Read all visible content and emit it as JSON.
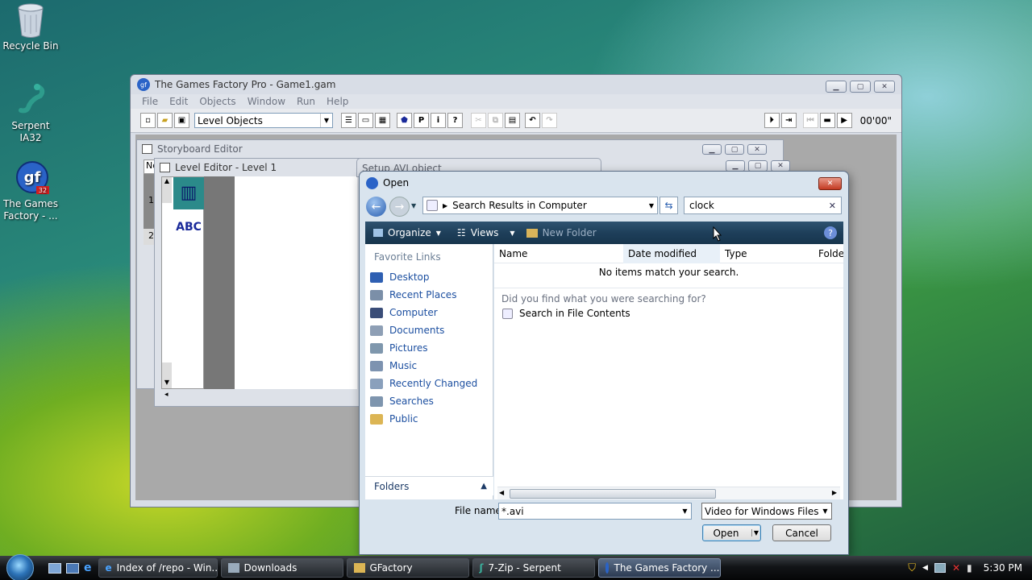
{
  "desktop": {
    "icons": [
      {
        "label": "Recycle Bin"
      },
      {
        "label": "Serpent IA32"
      },
      {
        "label": "The Games Factory - ..."
      }
    ]
  },
  "app": {
    "title": "The Games Factory Pro - Game1.gam",
    "menu": [
      "File",
      "Edit",
      "Objects",
      "Window",
      "Run",
      "Help"
    ],
    "objects_combo": "Level Objects",
    "timer": "00'00\""
  },
  "storyboard": {
    "title": "Storyboard Editor",
    "col_header": "No",
    "rows": [
      "1",
      "2"
    ]
  },
  "level_editor": {
    "title": "Level Editor - Level 1",
    "abc_label": "ABC"
  },
  "setup_avi": {
    "title": "Setup AVI object"
  },
  "open_dialog": {
    "title": "Open",
    "address": "Search Results in Computer",
    "search_value": "clock",
    "organize": "Organize",
    "views": "Views",
    "new_folder": "New Folder",
    "favorite_links": "Favorite Links",
    "links": [
      "Desktop",
      "Recent Places",
      "Computer",
      "Documents",
      "Pictures",
      "Music",
      "Recently Changed",
      "Searches",
      "Public"
    ],
    "folders": "Folders",
    "columns": [
      "Name",
      "Date modified",
      "Type",
      "Folde"
    ],
    "empty_message": "No items match your search.",
    "did_you_find": "Did you find what you were searching for?",
    "search_in_contents": "Search in File Contents",
    "filename_label": "File name:",
    "filename_value": "*.avi",
    "filetype": "Video for Windows Files",
    "open_btn": "Open",
    "cancel_btn": "Cancel"
  },
  "taskbar": {
    "buttons": [
      "Index of /repo - Win...",
      "Downloads",
      "GFactory",
      "7-Zip - Serpent",
      "The Games Factory ..."
    ],
    "clock": "5:30 PM"
  }
}
